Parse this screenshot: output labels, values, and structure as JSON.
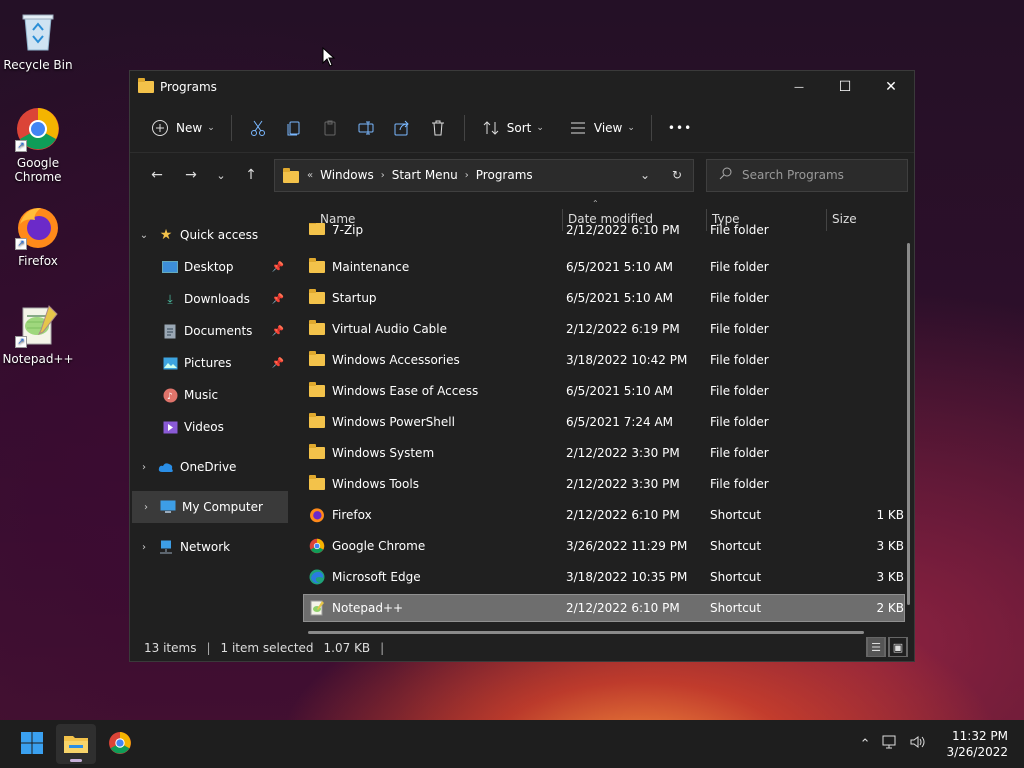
{
  "desktop": {
    "icons": [
      {
        "label": "Recycle Bin",
        "icon": "recycle-bin-icon"
      },
      {
        "label": "Google\nChrome",
        "icon": "chrome-icon"
      },
      {
        "label": "Firefox",
        "icon": "firefox-icon"
      },
      {
        "label": "Notepad++",
        "icon": "notepadpp-icon"
      }
    ]
  },
  "window": {
    "title": "Programs",
    "controls": {
      "minimize": "—",
      "maximize": "☐",
      "close": "✕"
    }
  },
  "toolbar": {
    "new_label": "New",
    "sort_label": "Sort",
    "view_label": "View",
    "more_label": "•••"
  },
  "address": {
    "overflow": "«",
    "crumbs": [
      "Windows",
      "Start Menu",
      "Programs"
    ]
  },
  "search": {
    "placeholder": "Search Programs"
  },
  "sidebar": {
    "quick_access": "Quick access",
    "items": [
      {
        "label": "Desktop",
        "pinned": true
      },
      {
        "label": "Downloads",
        "pinned": true
      },
      {
        "label": "Documents",
        "pinned": true
      },
      {
        "label": "Pictures",
        "pinned": true
      },
      {
        "label": "Music",
        "pinned": false
      },
      {
        "label": "Videos",
        "pinned": false
      }
    ],
    "onedrive": "OneDrive",
    "my_computer": "My Computer",
    "network": "Network"
  },
  "columns": {
    "name": "Name",
    "date": "Date modified",
    "type": "Type",
    "size": "Size"
  },
  "files": [
    {
      "name": "7-Zip",
      "date": "2/12/2022 6:10 PM",
      "type": "File folder",
      "size": "",
      "kind": "folder"
    },
    {
      "name": "Maintenance",
      "date": "6/5/2021 5:10 AM",
      "type": "File folder",
      "size": "",
      "kind": "folder"
    },
    {
      "name": "Startup",
      "date": "6/5/2021 5:10 AM",
      "type": "File folder",
      "size": "",
      "kind": "folder"
    },
    {
      "name": "Virtual Audio Cable",
      "date": "2/12/2022 6:19 PM",
      "type": "File folder",
      "size": "",
      "kind": "folder"
    },
    {
      "name": "Windows Accessories",
      "date": "3/18/2022 10:42 PM",
      "type": "File folder",
      "size": "",
      "kind": "folder"
    },
    {
      "name": "Windows Ease of Access",
      "date": "6/5/2021 5:10 AM",
      "type": "File folder",
      "size": "",
      "kind": "folder"
    },
    {
      "name": "Windows PowerShell",
      "date": "6/5/2021 7:24 AM",
      "type": "File folder",
      "size": "",
      "kind": "folder"
    },
    {
      "name": "Windows System",
      "date": "2/12/2022 3:30 PM",
      "type": "File folder",
      "size": "",
      "kind": "folder"
    },
    {
      "name": "Windows Tools",
      "date": "2/12/2022 3:30 PM",
      "type": "File folder",
      "size": "",
      "kind": "folder"
    },
    {
      "name": "Firefox",
      "date": "2/12/2022 6:10 PM",
      "type": "Shortcut",
      "size": "1 KB",
      "kind": "firefox"
    },
    {
      "name": "Google Chrome",
      "date": "3/26/2022 11:29 PM",
      "type": "Shortcut",
      "size": "3 KB",
      "kind": "chrome"
    },
    {
      "name": "Microsoft Edge",
      "date": "3/18/2022 10:35 PM",
      "type": "Shortcut",
      "size": "3 KB",
      "kind": "edge"
    },
    {
      "name": "Notepad++",
      "date": "2/12/2022 6:10 PM",
      "type": "Shortcut",
      "size": "2 KB",
      "kind": "notepad",
      "selected": true
    }
  ],
  "status": {
    "items": "13 items",
    "selected": "1 item selected",
    "size": "1.07 KB"
  },
  "taskbar": {
    "time": "11:32 PM",
    "date": "3/26/2022"
  }
}
